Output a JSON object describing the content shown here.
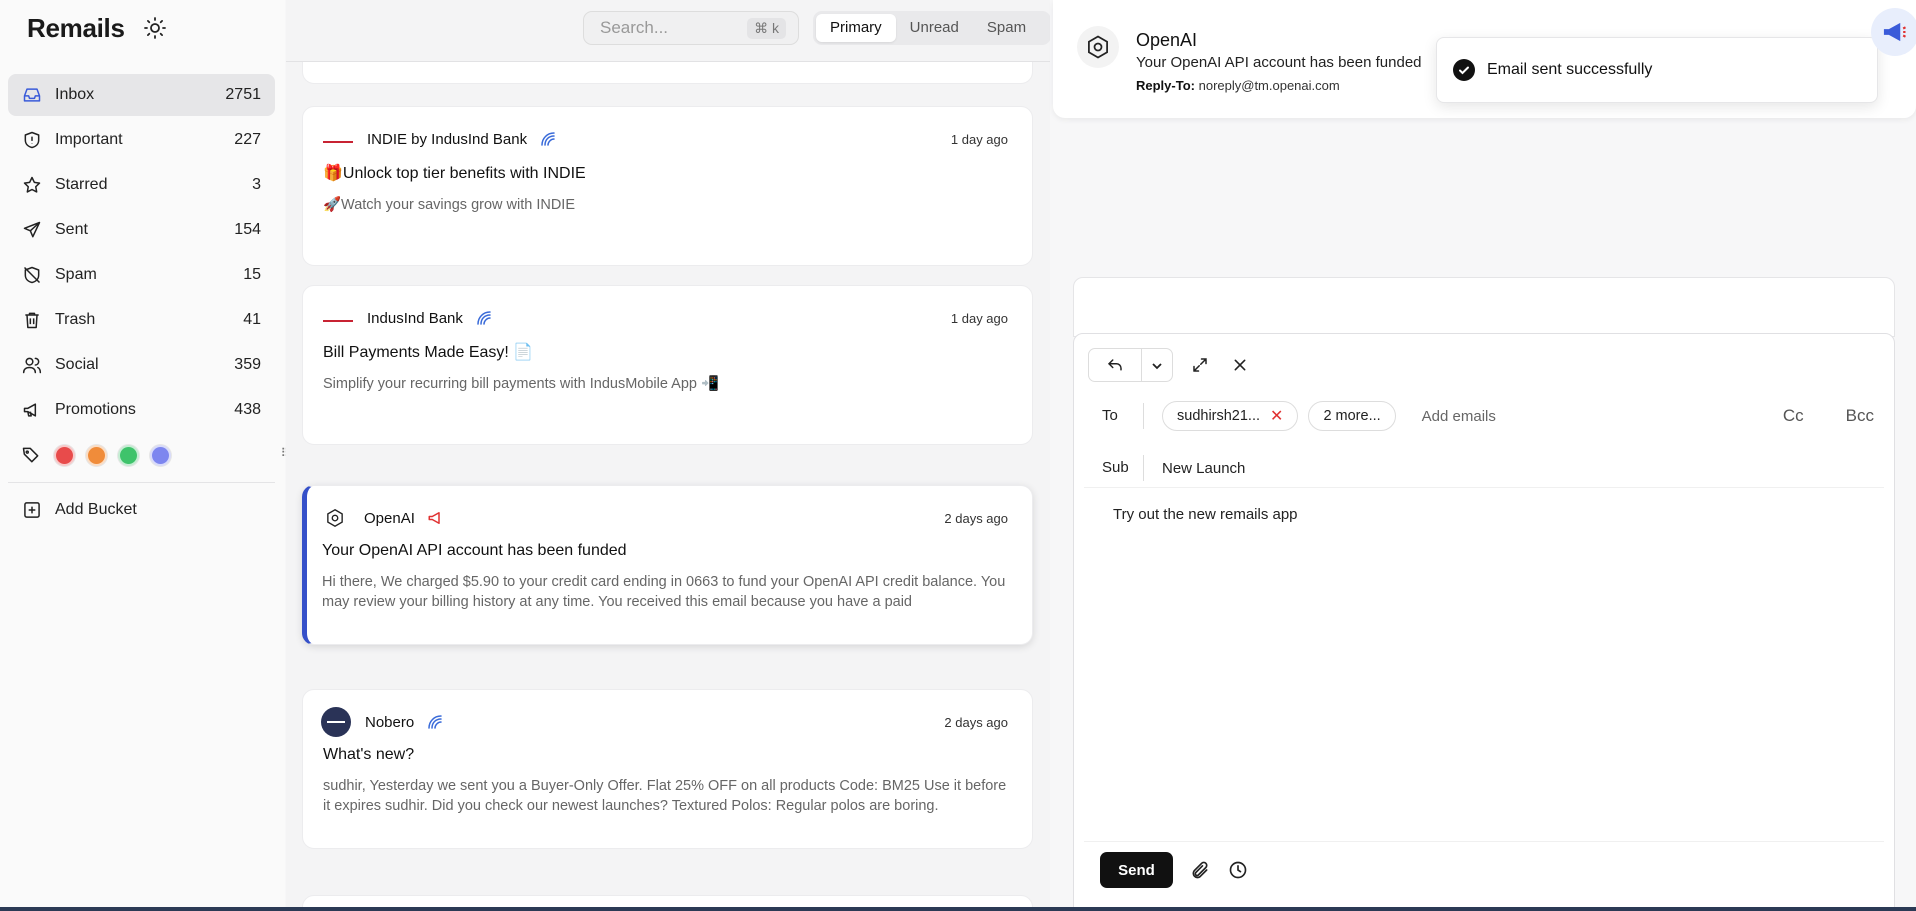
{
  "app": {
    "brand": "Remails"
  },
  "sidebar": {
    "items": [
      {
        "label": "Inbox",
        "count": "2751",
        "icon": "inbox-icon"
      },
      {
        "label": "Important",
        "count": "227",
        "icon": "shield-icon"
      },
      {
        "label": "Starred",
        "count": "3",
        "icon": "star-icon"
      },
      {
        "label": "Sent",
        "count": "154",
        "icon": "send-icon"
      },
      {
        "label": "Spam",
        "count": "15",
        "icon": "spam-shield-icon"
      },
      {
        "label": "Trash",
        "count": "41",
        "icon": "trash-icon"
      },
      {
        "label": "Social",
        "count": "359",
        "icon": "users-icon"
      },
      {
        "label": "Promotions",
        "count": "438",
        "icon": "megaphone-icon"
      }
    ],
    "tag_colors": [
      "#e84b4b",
      "#f08c3a",
      "#3fc36b",
      "#7d86ef"
    ],
    "add_bucket": "Add Bucket"
  },
  "search": {
    "placeholder": "Search...",
    "shortcut": "⌘  k"
  },
  "filters": [
    "Primary",
    "Unread",
    "Spam"
  ],
  "emails": [
    {
      "sender": "INDIE by IndusInd Bank",
      "date": "1 day ago",
      "subject": "🎁Unlock top tier benefits with INDIE",
      "preview": "🚀Watch your savings grow with INDIE"
    },
    {
      "sender": "IndusInd Bank",
      "date": "1 day ago",
      "subject": "Bill Payments Made Easy! 📄",
      "preview": "Simplify your recurring bill payments with IndusMobile App 📲"
    },
    {
      "sender": "OpenAI",
      "date": "2 days ago",
      "subject": "Your OpenAI API account has been funded",
      "preview": "Hi there, We charged $5.90 to your credit card ending in 0663 to fund your OpenAI API credit balance. You may review your billing history at any time. You received this email because you have a paid"
    },
    {
      "sender": "Nobero",
      "date": "2 days ago",
      "subject": "What's new?",
      "preview": "sudhir, Yesterday we sent you a Buyer-Only Offer. Flat 25% OFF on all products Code: BM25 Use it before it expires sudhir. Did you check our newest launches? Textured Polos: Regular polos are boring."
    }
  ],
  "detail": {
    "from": "OpenAI",
    "subject": "Your OpenAI API account has been funded",
    "reply_to_label": "Reply-To:",
    "reply_to": "noreply@tm.openai.com"
  },
  "toast": {
    "message": "Email sent successfully"
  },
  "compose": {
    "to_label": "To",
    "recipient_chip": "sudhirsh21...",
    "more_chip": "2 more...",
    "add_emails": "Add emails",
    "cc": "Cc",
    "bcc": "Bcc",
    "sub_label": "Sub",
    "subject": "New Launch",
    "body": "Try out the new remails app",
    "send": "Send"
  }
}
